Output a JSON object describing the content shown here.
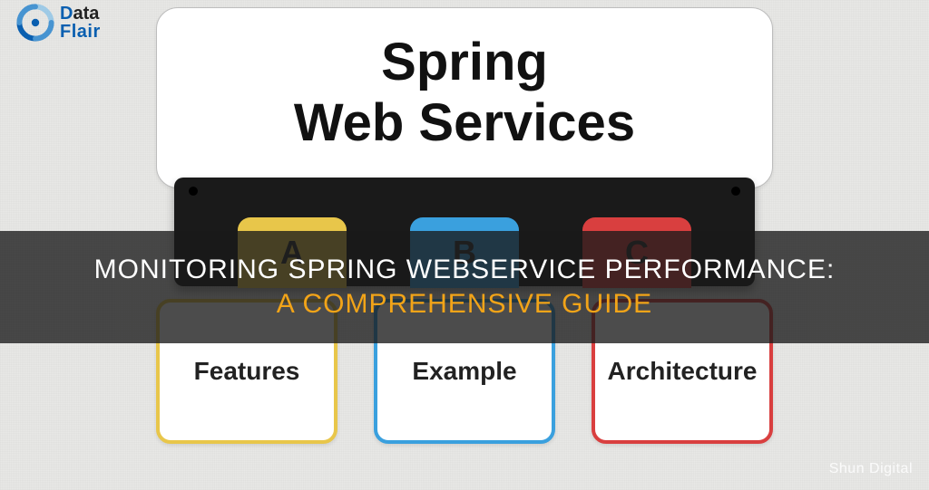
{
  "logo": {
    "brand_word1_first": "D",
    "brand_word1_rest": "ata",
    "brand_word2": "Flair"
  },
  "header": {
    "title_line1": "Spring",
    "title_line2": "Web Services"
  },
  "tabs": {
    "a": "A",
    "b": "B",
    "c": "C"
  },
  "cards": {
    "features": "Features",
    "example": "Example",
    "architecture": "Architecture"
  },
  "overlay": {
    "line1": "MONITORING SPRING WEBSERVICE PERFORMANCE:",
    "line2": "A COMPREHENSIVE GUIDE"
  },
  "attribution": "Shun Digital",
  "colors": {
    "tab_a": "#e8c64a",
    "tab_b": "#3aa0de",
    "tab_c": "#d93f3f",
    "overlay_accent": "#f2a418",
    "logo_accent": "#0a5fb0"
  }
}
